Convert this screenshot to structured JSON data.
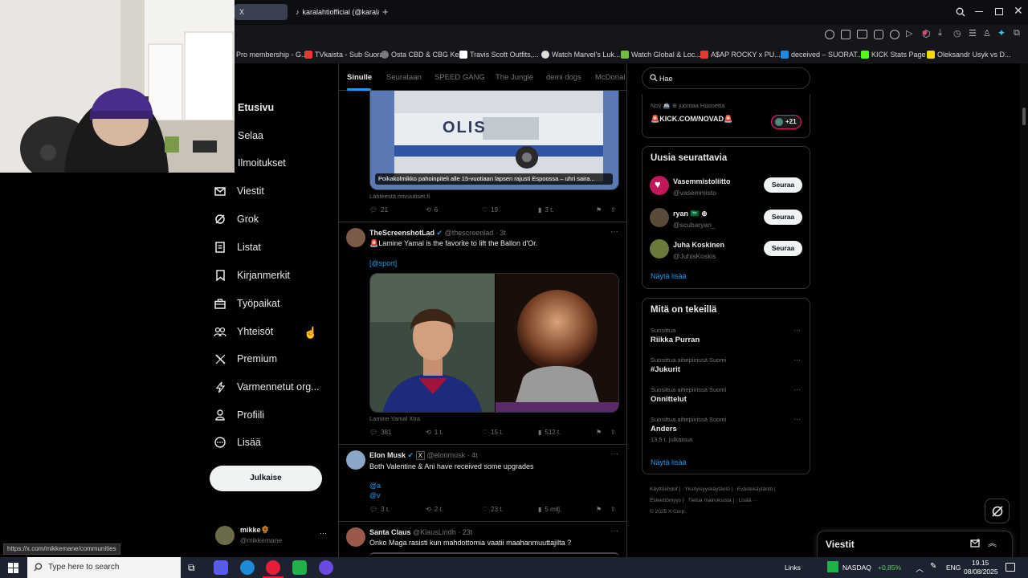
{
  "browser": {
    "tabs": [
      {
        "label": "X"
      },
      {
        "label": "karalahtiofficial (@karalahti"
      }
    ],
    "new_tab": "+",
    "bookmarks": [
      {
        "label": "Pro membership - G...",
        "color": "#4a90d9"
      },
      {
        "label": "TVkaista - Sub Suora",
        "color": "#e53935"
      },
      {
        "label": "Osta CBD & CBG Ke...",
        "color": "#7a7a7a"
      },
      {
        "label": "Travis Scott Outfits,...",
        "color": "#ffffff"
      },
      {
        "label": "Watch Marvel's Luk...",
        "color": "#dddddd"
      },
      {
        "label": "Watch Global & Loc...",
        "color": "#6fbf3a"
      },
      {
        "label": "A$AP ROCKY x PU...",
        "color": "#e53935"
      },
      {
        "label": "deceived – SUORAT...",
        "color": "#1e88e5"
      },
      {
        "label": "KICK Stats Page",
        "color": "#53fc18"
      },
      {
        "label": "Oleksandr Usyk vs D...",
        "color": "#f5d90a"
      }
    ],
    "status_url": "https://x.com/mikkemane/communities"
  },
  "nav": {
    "items": [
      {
        "label": "Etusivu",
        "icon": "home-icon"
      },
      {
        "label": "Selaa",
        "icon": "search-icon"
      },
      {
        "label": "Ilmoitukset",
        "icon": "bell-icon"
      },
      {
        "label": "Viestit",
        "icon": "mail-icon"
      },
      {
        "label": "Grok",
        "icon": "grok-icon"
      },
      {
        "label": "Listat",
        "icon": "list-icon"
      },
      {
        "label": "Kirjanmerkit",
        "icon": "bookmark-icon"
      },
      {
        "label": "Työpaikat",
        "icon": "briefcase-icon"
      },
      {
        "label": "Yhteisöt",
        "icon": "people-icon"
      },
      {
        "label": "Premium",
        "icon": "x-logo-icon"
      },
      {
        "label": "Varmennetut org...",
        "icon": "lightning-icon"
      },
      {
        "label": "Profiili",
        "icon": "person-icon"
      },
      {
        "label": "Lisää",
        "icon": "more-circle-icon"
      }
    ],
    "post_button": "Julkaise",
    "account": {
      "name": "mikke🌻",
      "handle": "@mikkemane",
      "more": "···"
    }
  },
  "feed": {
    "tabs": [
      "Sinulle",
      "Seurataan",
      "SPEED GANG",
      "The Jungle",
      "demi dogs",
      "McDonal"
    ],
    "tweet1": {
      "image_caption": "Poikakolmikko pahoinpiteli alle 15-vuotiaan lapsen rajusti Espoossa – uhri saira...",
      "image_text": "OLIS",
      "source": "Lähteestä mtvuutiset.fi",
      "stats": {
        "replies": "21",
        "reposts": "6",
        "likes": "19",
        "views": "3 t."
      }
    },
    "tweet2": {
      "name": "TheScreenshotLad",
      "handle": "@thescreenlad · 3t",
      "text": "🚨Lamine Yamal is the favorite to lift the Ballon d'Or.",
      "mention": "[@sport]",
      "source": "Lamine Yamal Xtra",
      "stats": {
        "replies": "381",
        "reposts": "1 t.",
        "likes": "15 t.",
        "views": "512 t."
      }
    },
    "tweet3": {
      "name": "Elon Musk",
      "handle": "@elonmusk · 4t",
      "text": "Both Valentine & Ani have received some upgrades",
      "link1": "@a",
      "link2": "@v",
      "stats": {
        "replies": "3 t.",
        "reposts": "2 t.",
        "likes": "23 t.",
        "views": "5 milj."
      }
    },
    "tweet4": {
      "name": "Santa Claus",
      "handle": "@KlausLindh · 23t",
      "text": "Onko Maga rasisti kun mahdottomia vaatii maahanmuuttajilta ?"
    }
  },
  "sidebar": {
    "search_placeholder": "Hae",
    "live": {
      "text": "Nov 🚢 ⊕ juontaa Huonetta",
      "title": "🚨KICK.COM/NOVAD🚨",
      "count": "+21"
    },
    "who_to_follow": {
      "title": "Uusia seurattavia",
      "users": [
        {
          "name": "Vasemmistoliitto",
          "handle": "@vasemmisto",
          "button": "Seuraa"
        },
        {
          "name": "ryan 🇸🇦 ⊕",
          "handle": "@scubaryan_",
          "button": "Seuraa"
        },
        {
          "name": "Juha Koskinen",
          "handle": "@JuhisKoskis",
          "button": "Seuraa"
        }
      ],
      "show_more": "Näytä lisää"
    },
    "trends": {
      "title": "Mitä on tekeillä",
      "items": [
        {
          "meta": "Suosittua",
          "name": "Riikka Purran",
          "extra": ""
        },
        {
          "meta": "Suosittua aihepiirissä Suomi",
          "name": "#Jukurit",
          "extra": ""
        },
        {
          "meta": "Suosittua aihepiirissä Suomi",
          "name": "Onnittelut",
          "extra": ""
        },
        {
          "meta": "Suosittua aihepiirissä Suomi",
          "name": "Anders",
          "extra": "13,5 t. julkaisua"
        }
      ],
      "show_more": "Näytä lisää"
    },
    "footer": [
      "Käyttöehdot",
      "Yksityisyyskäytäntö",
      "Evästekäytäntö",
      "Esteettömyys",
      "Tietoa mainoksista",
      "Lisää ···",
      "© 2025 X Corp."
    ]
  },
  "messages_drawer": {
    "title": "Viestit"
  },
  "taskbar": {
    "search_placeholder": "Type here to search",
    "links": "Links",
    "nasdaq": "NASDAQ",
    "nasdaq_change": "+0,85%",
    "lang": "ENG",
    "time": "19.15",
    "date": "08/08/2025"
  }
}
